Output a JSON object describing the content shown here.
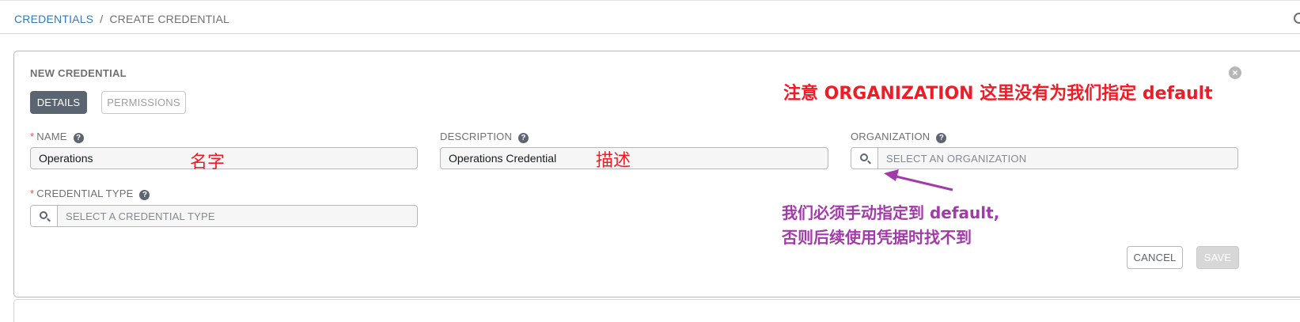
{
  "breadcrumb": {
    "parent": "CREDENTIALS",
    "separator": "/",
    "current": "CREATE CREDENTIAL"
  },
  "card": {
    "title": "NEW CREDENTIAL",
    "close_icon": "close-circle-icon",
    "tabs": [
      {
        "label": "DETAILS",
        "active": true
      },
      {
        "label": "PERMISSIONS",
        "active": false
      }
    ]
  },
  "form": {
    "name": {
      "required_mark": "*",
      "label": "NAME",
      "value": "Operations"
    },
    "description": {
      "label": "DESCRIPTION",
      "value": "Operations Credential"
    },
    "organization": {
      "label": "ORGANIZATION",
      "placeholder": "SELECT AN ORGANIZATION"
    },
    "credential_type": {
      "required_mark": "*",
      "label": "CREDENTIAL TYPE",
      "placeholder": "SELECT A CREDENTIAL TYPE"
    },
    "help_glyph": "?"
  },
  "actions": {
    "cancel_label": "CANCEL",
    "save_label": "SAVE"
  },
  "annotations": {
    "org_note": "注意 ORGANIZATION 这里没有为我们指定 default",
    "name_note": "名字",
    "description_note": "描述",
    "must_select_line1": "我们必须手动指定到 default,",
    "must_select_line2": "否则后续使用凭据时找不到",
    "red": "#ee1c25",
    "purple": "#a23aa9"
  },
  "colors": {
    "link": "#337ab7",
    "active_tab": "#5b6471",
    "required": "#d9534f"
  }
}
